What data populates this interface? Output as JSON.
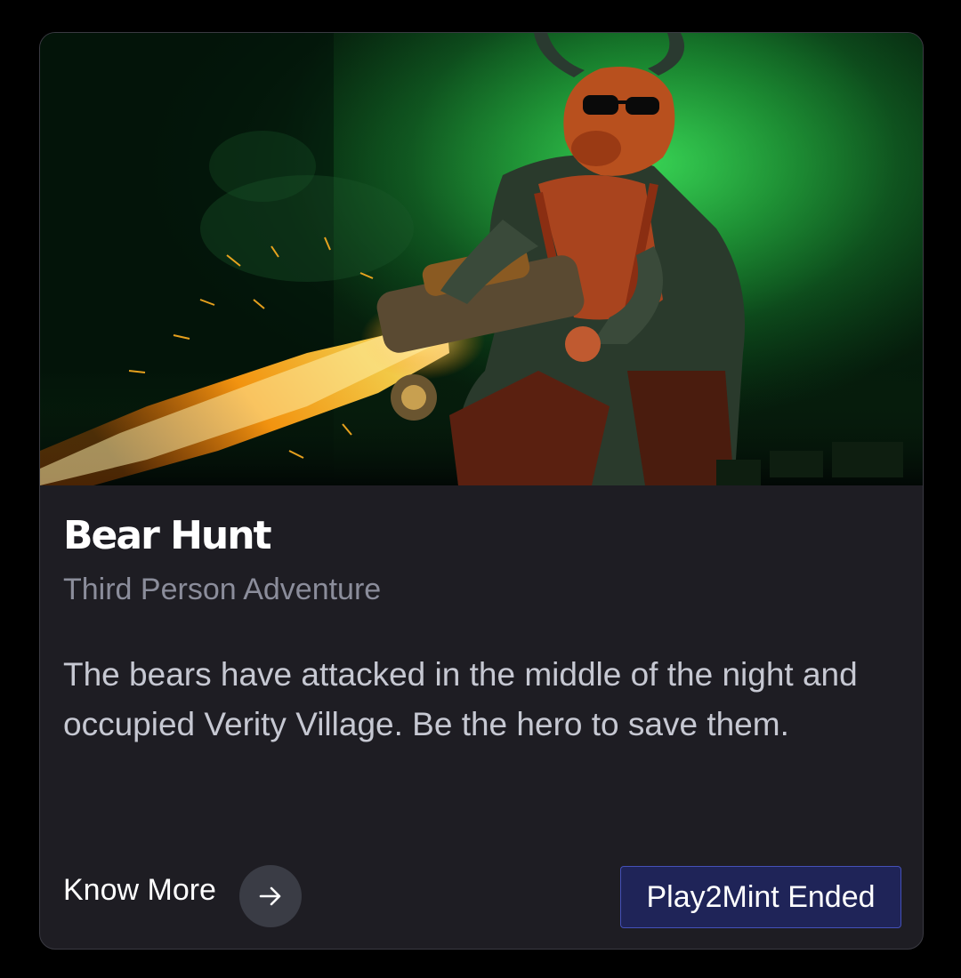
{
  "game": {
    "title": "Bear Hunt",
    "genre": "Third Person Adventure",
    "description": "The bears have attacked in the middle of the night and occupied Verity Village. Be the hero to save them."
  },
  "actions": {
    "know_more_label": "Know More",
    "know_more_icon": "arrow-right-icon",
    "status_label": "Play2Mint Ended"
  },
  "hero_image": {
    "alt": "Bull warrior with sunglasses firing a flaming weapon in green smoke"
  },
  "colors": {
    "card_background": "#1e1d23",
    "page_background": "#000000",
    "subtitle": "#8b8d9b",
    "description": "#c6c8d2",
    "status_button_bg": "#1f2458",
    "status_button_border": "#4450b8",
    "arrow_circle": "#3a3c45"
  }
}
